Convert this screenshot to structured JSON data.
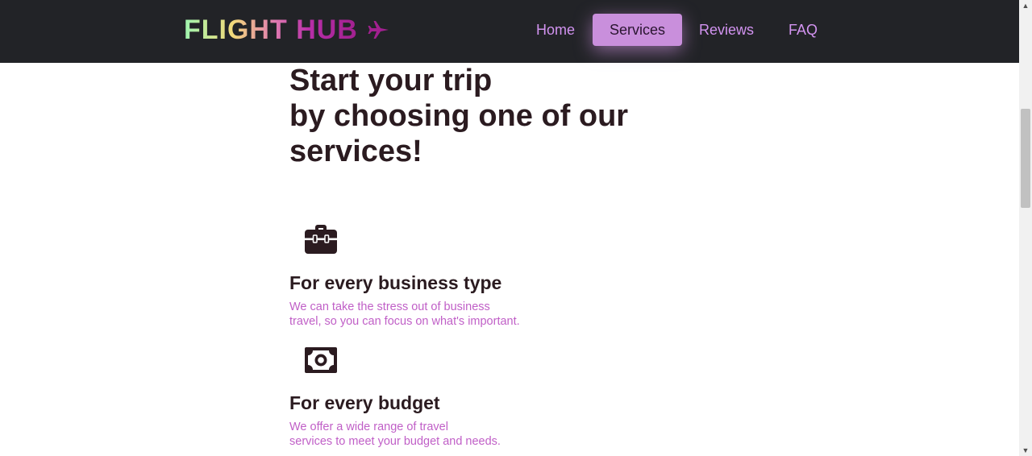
{
  "nav": {
    "logo_text": "FLIGHT HUB",
    "logo_icon": "plane-icon",
    "items": [
      {
        "label": "Home",
        "active": false
      },
      {
        "label": "Services",
        "active": true
      },
      {
        "label": "Reviews",
        "active": false
      },
      {
        "label": "FAQ",
        "active": false
      }
    ]
  },
  "hero": {
    "line1": "Start your trip",
    "line2": "by choosing one of our services!"
  },
  "features": [
    {
      "icon": "briefcase-icon",
      "title": "For every business type",
      "description": "We can take the stress out of business\ntravel, so you can focus on what's important."
    },
    {
      "icon": "money-bill-icon",
      "title": "For every budget",
      "description": "We offer a wide range of travel\nservices to meet your budget and needs."
    }
  ],
  "colors": {
    "navbar_bg": "#222327",
    "nav_link": "#d293f0",
    "nav_active_bg": "#c98fdc",
    "heading_text": "#2b1b20",
    "description_text": "#c05fc7"
  }
}
